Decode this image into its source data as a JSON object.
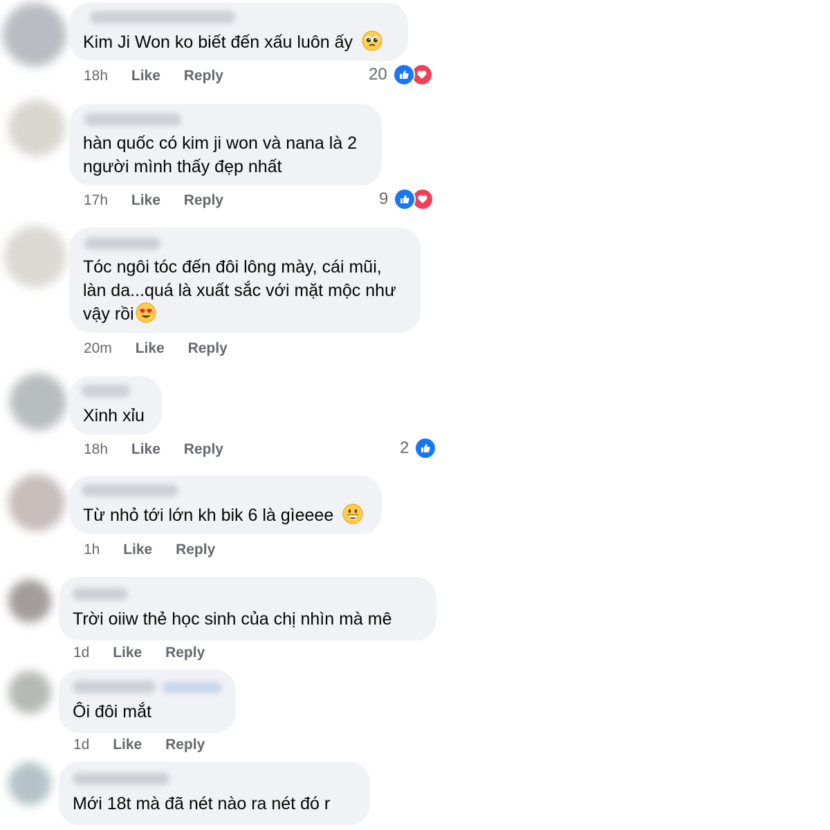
{
  "ui": {
    "like_label": "Like",
    "reply_label": "Reply"
  },
  "comments": [
    {
      "text_lines": [
        "Kim Ji Won ko biết đến xấu luôn ấy"
      ],
      "emoji": "pleading-face-emoji",
      "time": "18h",
      "reaction_count": "20",
      "reactions": [
        "like",
        "love"
      ]
    },
    {
      "text_lines": [
        "hàn quốc có kim ji won và nana là 2",
        "người mình thấy đẹp nhất"
      ],
      "time": "17h",
      "reaction_count": "9",
      "reactions": [
        "like",
        "love"
      ]
    },
    {
      "text_lines": [
        "Tóc ngôi tóc đến đôi lông mày, cái mũi,",
        "làn da...quá là xuất sắc với mặt mộc như",
        "vậy rồi"
      ],
      "emoji": "heart-eyes-emoji",
      "time": "20m"
    },
    {
      "text_lines": [
        "Xinh xỉu"
      ],
      "time": "18h",
      "reaction_count": "2",
      "reactions": [
        "like"
      ]
    },
    {
      "text_lines": [
        "Từ nhỏ tới lớn kh bik 6 là gìeeee"
      ],
      "emoji": "grinning-face-emoji",
      "time": "1h"
    },
    {
      "text_lines": [
        "Trời oiiw thẻ học sinh của chị nhìn mà mê"
      ],
      "time": "1d"
    },
    {
      "text_lines": [
        "Ôi đôi mắt"
      ],
      "time": "1d"
    },
    {
      "text_lines": [
        "Mới 18t mà đã nét nào ra nét đó r"
      ]
    }
  ],
  "colors": {
    "like_blue": "#1877f2",
    "love_red": "#f33e58",
    "bubble_bg": "#f0f2f5",
    "meta_gray": "#65676b"
  }
}
